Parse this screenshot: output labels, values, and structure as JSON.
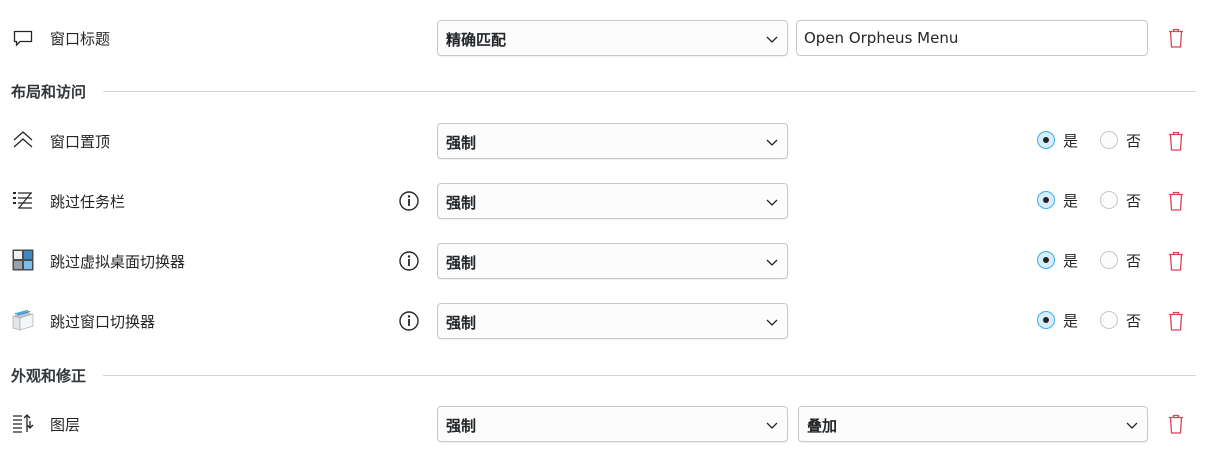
{
  "rows": {
    "window_title": {
      "label": "窗口标题",
      "match_mode": "精确匹配",
      "value": "Open Orpheus Menu"
    },
    "keep_above": {
      "label": "窗口置顶",
      "policy": "强制",
      "yes": "是",
      "no": "否",
      "selected": "是"
    },
    "skip_taskbar": {
      "label": "跳过任务栏",
      "policy": "强制",
      "yes": "是",
      "no": "否",
      "selected": "是"
    },
    "skip_pager": {
      "label": "跳过虚拟桌面切换器",
      "policy": "强制",
      "yes": "是",
      "no": "否",
      "selected": "是"
    },
    "skip_switcher": {
      "label": "跳过窗口切换器",
      "policy": "强制",
      "yes": "是",
      "no": "否",
      "selected": "是"
    },
    "layer": {
      "label": "图层",
      "policy": "强制",
      "value": "叠加"
    }
  },
  "sections": {
    "layout_access": "布局和访问",
    "appearance_fixes": "外观和修正"
  },
  "colors": {
    "accent": "#3daee9",
    "delete": "#da4453",
    "text": "#232629"
  },
  "icons": {
    "window_title": "window-title-icon",
    "keep_above": "keep-above-icon",
    "skip_taskbar": "skip-taskbar-icon",
    "skip_pager": "skip-pager-icon",
    "skip_switcher": "skip-switcher-icon",
    "layer": "layer-icon",
    "info": "info-icon",
    "delete": "trash-icon",
    "dropdown": "chevron-down-icon"
  }
}
